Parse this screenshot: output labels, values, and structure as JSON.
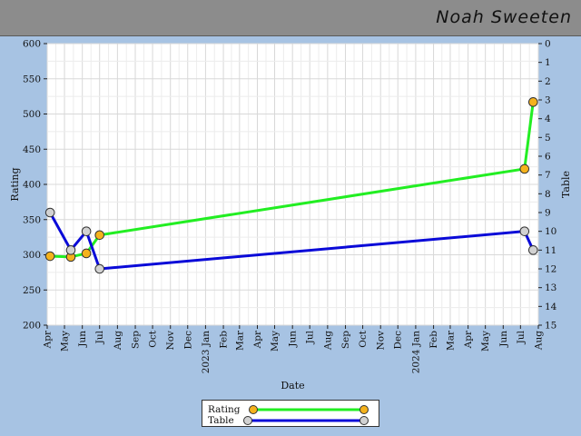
{
  "header": {
    "title": "Noah Sweeten"
  },
  "chart_data": {
    "type": "line",
    "xlabel": "Date",
    "ylabel_left": "Rating",
    "ylabel_right": "Table",
    "y_left_range": [
      200,
      600
    ],
    "y_left_ticks": [
      200,
      250,
      300,
      350,
      400,
      450,
      500,
      550,
      600
    ],
    "y_right_range": [
      15,
      0
    ],
    "y_right_ticks": [
      0,
      1,
      2,
      3,
      4,
      5,
      6,
      7,
      8,
      9,
      10,
      11,
      12,
      13,
      14,
      15
    ],
    "grid": true,
    "legend_placement": "bottom-center",
    "x_range": [
      "2022-04-01",
      "2024-08-01"
    ],
    "x_tick_labels": [
      {
        "date": "2022-04-01",
        "label": "Apr"
      },
      {
        "date": "2022-05-01",
        "label": "May"
      },
      {
        "date": "2022-06-01",
        "label": "Jun"
      },
      {
        "date": "2022-07-01",
        "label": "Jul"
      },
      {
        "date": "2022-08-01",
        "label": "Aug"
      },
      {
        "date": "2022-09-01",
        "label": "Sep"
      },
      {
        "date": "2022-10-01",
        "label": "Oct"
      },
      {
        "date": "2022-11-01",
        "label": "Nov"
      },
      {
        "date": "2022-12-01",
        "label": "Dec"
      },
      {
        "date": "2023-01-01",
        "label": "2023 Jan"
      },
      {
        "date": "2023-02-01",
        "label": "Feb"
      },
      {
        "date": "2023-03-01",
        "label": "Mar"
      },
      {
        "date": "2023-04-01",
        "label": "Apr"
      },
      {
        "date": "2023-05-01",
        "label": "May"
      },
      {
        "date": "2023-06-01",
        "label": "Jun"
      },
      {
        "date": "2023-07-01",
        "label": "Jul"
      },
      {
        "date": "2023-08-01",
        "label": "Aug"
      },
      {
        "date": "2023-09-01",
        "label": "Sep"
      },
      {
        "date": "2023-10-01",
        "label": "Oct"
      },
      {
        "date": "2023-11-01",
        "label": "Nov"
      },
      {
        "date": "2023-12-01",
        "label": "Dec"
      },
      {
        "date": "2024-01-01",
        "label": "2024 Jan"
      },
      {
        "date": "2024-02-01",
        "label": "Feb"
      },
      {
        "date": "2024-03-01",
        "label": "Mar"
      },
      {
        "date": "2024-04-01",
        "label": "Apr"
      },
      {
        "date": "2024-05-01",
        "label": "May"
      },
      {
        "date": "2024-06-01",
        "label": "Jun"
      },
      {
        "date": "2024-07-01",
        "label": "Jul"
      },
      {
        "date": "2024-08-01",
        "label": "Aug"
      }
    ],
    "series": [
      {
        "name": "Rating",
        "axis": "left",
        "color": "#22ee22",
        "marker_color": "#f5b21c",
        "points": [
          {
            "x": "2022-04-06",
            "y": 298
          },
          {
            "x": "2022-05-12",
            "y": 297
          },
          {
            "x": "2022-06-08",
            "y": 302
          },
          {
            "x": "2022-07-01",
            "y": 328
          },
          {
            "x": "2024-07-08",
            "y": 422
          },
          {
            "x": "2024-07-23",
            "y": 517
          }
        ]
      },
      {
        "name": "Table",
        "axis": "right",
        "color": "#0a0ad8",
        "marker_color": "#d2d2d2",
        "points": [
          {
            "x": "2022-04-06",
            "y": 9
          },
          {
            "x": "2022-05-12",
            "y": 11
          },
          {
            "x": "2022-06-08",
            "y": 10
          },
          {
            "x": "2022-07-01",
            "y": 12
          },
          {
            "x": "2024-07-08",
            "y": 10
          },
          {
            "x": "2024-07-23",
            "y": 11
          }
        ]
      }
    ]
  }
}
